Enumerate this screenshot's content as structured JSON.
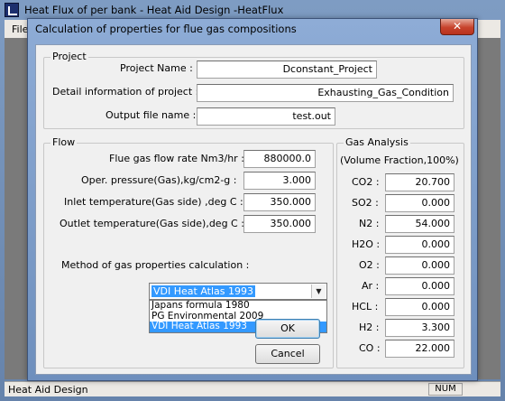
{
  "main_window": {
    "title": "Heat Flux of per bank - Heat Aid Design -HeatFlux",
    "menu_file": "File",
    "status_text": "Heat Aid Design",
    "status_num": "NUM"
  },
  "dialog": {
    "title": "Calculation of properties for flue gas compositions",
    "close_glyph": "✕"
  },
  "project": {
    "legend": "Project",
    "name_label": "Project Name :",
    "name_value": "Dconstant_Project",
    "detail_label": "Detail information of project :",
    "detail_value": "Exhausting_Gas_Condition",
    "output_label": "Output file name :",
    "output_value": "test.out"
  },
  "flow": {
    "legend": "Flow",
    "flow_rate_label": "Flue gas flow rate Nm3/hr :",
    "flow_rate_value": "880000.0",
    "pressure_label": "Oper. pressure(Gas),kg/cm2-g :",
    "pressure_value": "3.000",
    "inlet_label": "Inlet temperature(Gas side) ,deg C :",
    "inlet_value": "350.000",
    "outlet_label": "Outlet temperature(Gas side),deg C :",
    "outlet_value": "350.000"
  },
  "method": {
    "label": "Method of gas properties calculation :",
    "selected": "VDI Heat Atlas 1993",
    "options": [
      "Japans formula 1980",
      "PG Environmental  2009",
      "VDI Heat Atlas 1993"
    ]
  },
  "gas_analysis": {
    "legend": "Gas Analysis",
    "subtitle": "(Volume Fraction,100%)",
    "components": [
      {
        "label": "CO2 :",
        "value": "20.700"
      },
      {
        "label": "SO2 :",
        "value": "0.000"
      },
      {
        "label": "N2 :",
        "value": "54.000"
      },
      {
        "label": "H2O :",
        "value": "0.000"
      },
      {
        "label": "O2 :",
        "value": "0.000"
      },
      {
        "label": "Ar :",
        "value": "0.000"
      },
      {
        "label": "HCL :",
        "value": "0.000"
      },
      {
        "label": "H2 :",
        "value": "3.300"
      },
      {
        "label": "CO :",
        "value": "22.000"
      }
    ]
  },
  "buttons": {
    "ok": "OK",
    "cancel": "Cancel"
  }
}
